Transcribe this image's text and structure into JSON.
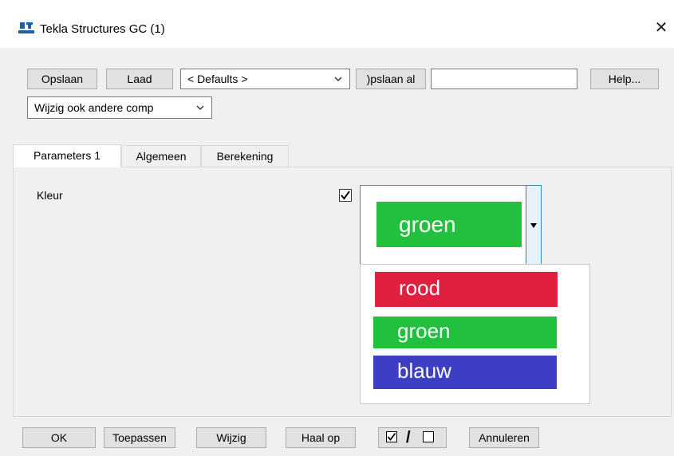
{
  "window": {
    "title": "Tekla Structures  GC (1)",
    "close_glyph": "✕"
  },
  "toolbar": {
    "save_label": "Opslaan",
    "load_label": "Laad",
    "preset_value": "< Defaults >",
    "save_as_label": ")pslaan al",
    "save_as_input_value": "",
    "help_label": "Help...",
    "modify_filter_value": "Wijzig ook andere comp"
  },
  "tabs": [
    {
      "label": "Parameters 1",
      "active": true
    },
    {
      "label": "Algemeen",
      "active": false
    },
    {
      "label": "Berekening",
      "active": false
    }
  ],
  "params": {
    "color_label": "Kleur",
    "color_checked": true,
    "color_selected": {
      "label": "groen",
      "color": "#22c03f"
    },
    "color_options": [
      {
        "label": "rood",
        "color": "#e0203e"
      },
      {
        "label": "groen",
        "color": "#22c03f"
      },
      {
        "label": "blauw",
        "color": "#3e3ec5"
      }
    ]
  },
  "footer": {
    "ok_label": "OK",
    "apply_label": "Toepassen",
    "modify_label": "Wijzig",
    "get_label": "Haal op",
    "toggle_label": "/",
    "cancel_label": "Annuleren"
  },
  "colors": {
    "window_bg": "#f0f0f0",
    "dropdown_button_bg": "#e5f1fb",
    "dropdown_button_border": "#3c7fb1"
  }
}
